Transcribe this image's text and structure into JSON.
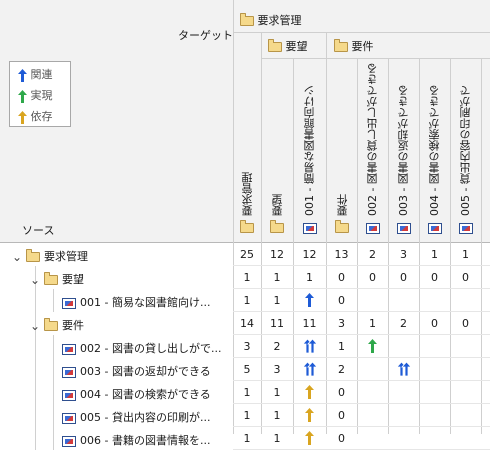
{
  "header": {
    "target_label": "ターゲット",
    "source_label": "ソース",
    "group_top": "要求管理",
    "group_youbou": "要望",
    "group_youken": "要件"
  },
  "legend": {
    "items": [
      {
        "label": "関連",
        "color": "#1e5bd6",
        "icon": "up-arrow-icon"
      },
      {
        "label": "実現",
        "color": "#2ea84a",
        "icon": "up-arrow-icon"
      },
      {
        "label": "依存",
        "color": "#d9a520",
        "icon": "up-arrow-icon"
      }
    ]
  },
  "columns": [
    {
      "label": "要求管理",
      "type": "folder"
    },
    {
      "label": "要望",
      "type": "folder"
    },
    {
      "label": "001 - 簡易な図書館向けシ",
      "type": "req"
    },
    {
      "label": "要件",
      "type": "folder"
    },
    {
      "label": "002 - 図書の貸し出しができる",
      "type": "req"
    },
    {
      "label": "003 - 図書の返却ができる",
      "type": "req"
    },
    {
      "label": "004 - 図書の検索ができる",
      "type": "req"
    },
    {
      "label": "005 - 貸出内容の印刷がで",
      "type": "req"
    }
  ],
  "rows": [
    {
      "label": "要求管理",
      "type": "folder",
      "expand": "⌄",
      "cells": [
        "25",
        "12",
        "12",
        "13",
        "2",
        "3",
        "1",
        "1"
      ]
    },
    {
      "label": "要望",
      "type": "folder",
      "expand": "⌄",
      "cells": [
        "1",
        "1",
        "1",
        "0",
        "0",
        "0",
        "0",
        "0"
      ]
    },
    {
      "label": "001 - 簡易な図書館向け...",
      "type": "req",
      "expand": "",
      "cells": [
        "1",
        "1",
        "↑b",
        "0",
        "",
        "",
        "",
        ""
      ]
    },
    {
      "label": "要件",
      "type": "folder",
      "expand": "⌄",
      "cells": [
        "14",
        "11",
        "11",
        "3",
        "1",
        "2",
        "0",
        "0"
      ]
    },
    {
      "label": "002 - 図書の貸し出しがで...",
      "type": "req",
      "expand": "",
      "cells": [
        "3",
        "2",
        "⇈b",
        "1",
        "↑g",
        "",
        "",
        ""
      ]
    },
    {
      "label": "003 - 図書の返却ができる",
      "type": "req",
      "expand": "",
      "cells": [
        "5",
        "3",
        "⇈b",
        "2",
        "",
        "⇈b",
        "",
        ""
      ]
    },
    {
      "label": "004 - 図書の検索ができる",
      "type": "req",
      "expand": "",
      "cells": [
        "1",
        "1",
        "↑o",
        "0",
        "",
        "",
        "",
        ""
      ]
    },
    {
      "label": "005 - 貸出内容の印刷が...",
      "type": "req",
      "expand": "",
      "cells": [
        "1",
        "1",
        "↑o",
        "0",
        "",
        "",
        "",
        ""
      ]
    },
    {
      "label": "006 - 書籍の図書情報を...",
      "type": "req",
      "expand": "",
      "cells": [
        "1",
        "1",
        "↑o",
        "0",
        "",
        "",
        "",
        ""
      ]
    }
  ]
}
